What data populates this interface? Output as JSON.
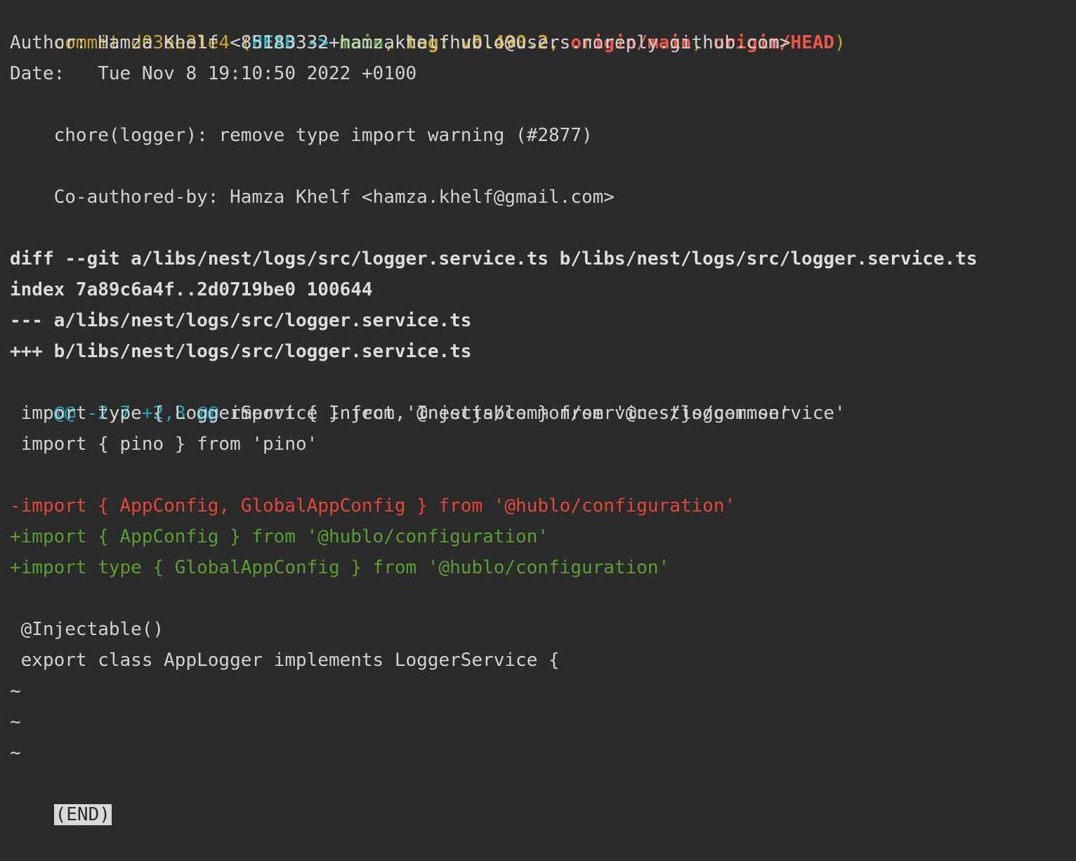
{
  "commit": {
    "label": "commit",
    "hash": "d03ae31e4",
    "open_paren": " (",
    "head": "HEAD -> ",
    "branch": "main",
    "sep1": ", ",
    "tag": "tag: v0.490.2",
    "sep2": ", ",
    "origin_main": "origin/main",
    "sep3": ", ",
    "origin_head": "origin/HEAD",
    "close_paren": ")"
  },
  "author_line": "Author: Hamza Khelf <85183332+hamzakhelfhublo@users.noreply.github.com>",
  "date_line": "Date:   Tue Nov 8 19:10:50 2022 +0100",
  "message": "    chore(logger): remove type import warning (#2877)",
  "coauthor": "    Co-authored-by: Hamza Khelf <hamza.khelf@gmail.com>",
  "diff_header": {
    "diff": "diff --git a/libs/nest/logs/src/logger.service.ts b/libs/nest/logs/src/logger.service.ts",
    "index": "index 7a89c6a4f..2d0719be0 100644",
    "minus": "--- a/libs/nest/logs/src/logger.service.ts",
    "plus": "+++ b/libs/nest/logs/src/logger.service.ts"
  },
  "hunk": {
    "range": "@@ -2,7 +2,8 @@",
    "context": " import { Inject, Injectable } from '@nestjs/common'"
  },
  "lines": {
    "ctx1": " import type { LoggerService } from '@nestjs/common/services/logger.service'",
    "ctx2": " import { pino } from 'pino'",
    "del1": "-import { AppConfig, GlobalAppConfig } from '@hublo/configuration'",
    "add1": "+import { AppConfig } from '@hublo/configuration'",
    "add2": "+import type { GlobalAppConfig } from '@hublo/configuration'",
    "ctx3": " @Injectable()",
    "ctx4": " export class AppLogger implements LoggerService {"
  },
  "tildes": [
    "~",
    "~",
    "~"
  ],
  "end_marker": "(END)"
}
